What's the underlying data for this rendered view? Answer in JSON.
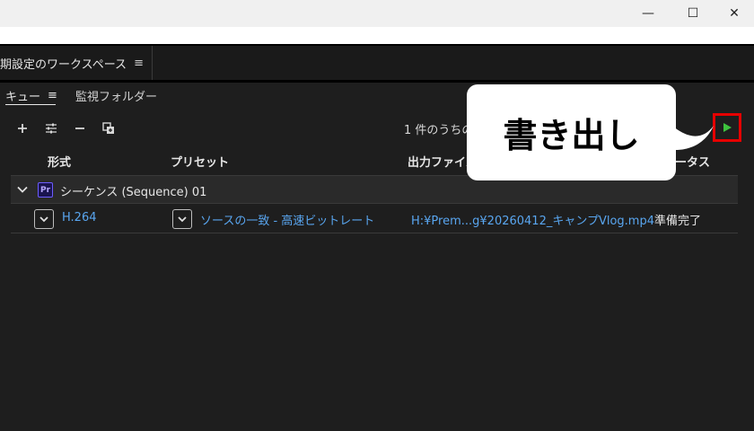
{
  "window": {
    "minimize_glyph": "—",
    "maximize_glyph": "☐",
    "close_glyph": "✕"
  },
  "workspace": {
    "tab_label": "初期設定のワークスペース",
    "menu_glyph": "≡"
  },
  "panel_tabs": {
    "queue_label": "キュー",
    "queue_menu_glyph": "≡",
    "watch_folder_label": "監視フォルダー"
  },
  "toolbar": {
    "queue_status_text": "1 件のうちの"
  },
  "columns": {
    "format": "形式",
    "preset": "プリセット",
    "output_file": "出力ファイル",
    "status": "ータス"
  },
  "queue": {
    "group": {
      "badge": "Pr",
      "label": "シーケンス (Sequence) 01"
    },
    "item": {
      "format": "H.264",
      "preset": "ソースの一致 - 高速ビットレート",
      "output_file": "H:¥Prem...g¥20260412_キャンプVlog.mp4",
      "status": "準備完了"
    }
  },
  "callout": {
    "text": "書き出し"
  },
  "colors": {
    "play_icon": "#3ec33e",
    "highlight_box": "#e60000",
    "link": "#59a6f0"
  }
}
